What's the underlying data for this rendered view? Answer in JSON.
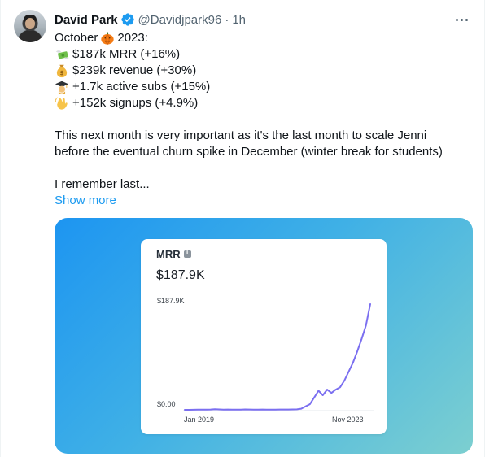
{
  "tweet": {
    "author": {
      "name": "David Park",
      "handle": "@Davidjpark96",
      "separator": "·",
      "time": "1h",
      "verified_color": "#1d9bf0"
    },
    "lines": [
      {
        "emoji": "",
        "text": "October ",
        "emoji_inline": "pumpkin-emoji",
        "text_after": " 2023:"
      },
      {
        "emoji": "money-with-wings-emoji",
        "text": "$187k MRR (+16%)"
      },
      {
        "emoji": "money-bag-emoji",
        "text": "$239k revenue (+30%)"
      },
      {
        "emoji": "graduation-cap-emoji",
        "text": "+1.7k active subs (+15%)"
      },
      {
        "emoji": "waving-hand-emoji",
        "text": "+152k signups (+4.9%)"
      }
    ],
    "paragraph_1": "This next month is very important as it's the last month to scale Jenni",
    "paragraph_2": "before the eventual churn spike in December (winter break for students)",
    "paragraph_3": "I remember last...",
    "show_more": "Show more",
    "link_color": "#1d9bf0"
  },
  "card": {
    "metric_label": "MRR",
    "metric_value": "$187.9K",
    "gradient": [
      "#1d95f1",
      "#3fb0e6",
      "#7ccfd0"
    ]
  },
  "chart_data": {
    "type": "line",
    "title": "MRR",
    "ytick_labels": [
      "$187.9K",
      "$0.00"
    ],
    "xtick_labels": [
      "Jan 2019",
      "Nov 2023"
    ],
    "ylim": [
      0,
      187.9
    ],
    "line_color": "#7b6ff0",
    "series": [
      {
        "values_k": [
          0,
          0,
          0.2,
          0.3,
          0.5,
          0.3,
          0.6,
          1.2,
          0.7,
          0.5,
          0.6,
          0.5,
          0.4,
          0.5,
          0.7,
          0.6,
          0.5,
          0.5,
          0.6,
          0.4,
          0.5,
          0.5,
          0.6,
          0.6,
          0.6,
          0.7,
          0.9,
          2.0,
          6.0,
          10.0,
          22.0,
          34.0,
          26.0,
          36.0,
          30.0,
          36.0,
          40.0,
          52.0,
          68.0,
          84.0,
          104.0,
          126.0,
          150.0,
          187.9
        ]
      }
    ]
  }
}
